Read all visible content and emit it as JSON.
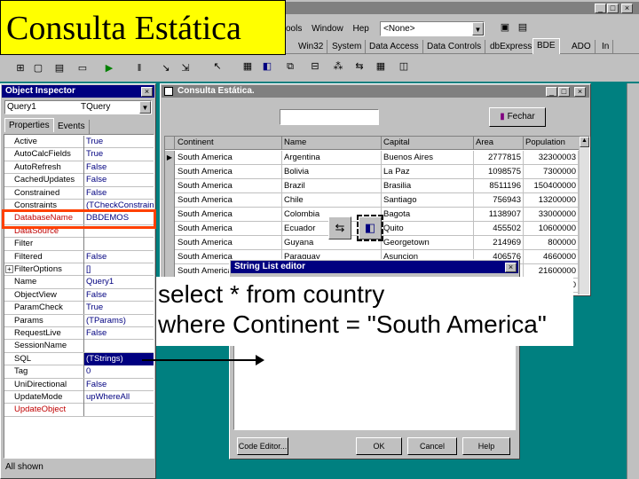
{
  "slide_title": "Consulta Estática",
  "ide": {
    "menu": [
      "ools",
      "Window",
      "Hep"
    ],
    "combo_value": "<None>",
    "palette_tabs": [
      "Win32",
      "System",
      "Data Access",
      "Data Controls",
      "dbExpress",
      "BDE",
      "ADO",
      "In"
    ]
  },
  "object_inspector": {
    "title": "Object Inspector",
    "component_name": "Query1",
    "component_type": "TQuery",
    "tabs": [
      "Properties",
      "Events"
    ],
    "properties": [
      {
        "name": "Active",
        "value": "True"
      },
      {
        "name": "AutoCalcFields",
        "value": "True"
      },
      {
        "name": "AutoRefresh",
        "value": "False"
      },
      {
        "name": "CachedUpdates",
        "value": "False"
      },
      {
        "name": "Constrained",
        "value": "False"
      },
      {
        "name": "Constraints",
        "value": "(TCheckConstraint"
      },
      {
        "name": "DatabaseName",
        "value": "DBDEMOS"
      },
      {
        "name": "DataSource",
        "value": ""
      },
      {
        "name": "Filter",
        "value": ""
      },
      {
        "name": "Filtered",
        "value": "False"
      },
      {
        "name": "FilterOptions",
        "value": "[]"
      },
      {
        "name": "Name",
        "value": "Query1"
      },
      {
        "name": "ObjectView",
        "value": "False"
      },
      {
        "name": "ParamCheck",
        "value": "True"
      },
      {
        "name": "Params",
        "value": "(TParams)"
      },
      {
        "name": "RequestLive",
        "value": "False"
      },
      {
        "name": "SessionName",
        "value": ""
      },
      {
        "name": "SQL",
        "value": "(TStrings)"
      },
      {
        "name": "Tag",
        "value": "0"
      },
      {
        "name": "UniDirectional",
        "value": "False"
      },
      {
        "name": "UpdateMode",
        "value": "upWhereAll"
      },
      {
        "name": "UpdateObject",
        "value": ""
      }
    ],
    "status": "All shown"
  },
  "form": {
    "title": "Consulta Estática.",
    "fechar_label": "Fechar",
    "grid": {
      "columns": [
        "Continent",
        "Name",
        "Capital",
        "Area",
        "Population"
      ],
      "rows": [
        [
          "South America",
          "Argentina",
          "Buenos Aires",
          "2777815",
          "32300003"
        ],
        [
          "South America",
          "Bolivia",
          "La Paz",
          "1098575",
          "7300000"
        ],
        [
          "South America",
          "Brazil",
          "Brasilia",
          "8511196",
          "150400000"
        ],
        [
          "South America",
          "Chile",
          "Santiago",
          "756943",
          "13200000"
        ],
        [
          "South America",
          "Colombia",
          "Bagota",
          "1138907",
          "33000000"
        ],
        [
          "South America",
          "Ecuador",
          "Quito",
          "455502",
          "10600000"
        ],
        [
          "South America",
          "Guyana",
          "Georgetown",
          "214969",
          "800000"
        ],
        [
          "South America",
          "Paraguay",
          "Asuncion",
          "406576",
          "4660000"
        ],
        [
          "South America",
          "",
          "",
          "",
          "21600000"
        ],
        [
          "",
          "",
          "",
          "",
          "0"
        ],
        [
          "",
          "",
          "",
          "",
          "0"
        ]
      ]
    }
  },
  "string_editor": {
    "title": "String List editor",
    "lines": [
      "select * from country",
      "where Continent = \"South America\""
    ],
    "buttons": {
      "code_editor": "Code Editor...",
      "ok": "OK",
      "cancel": "Cancel",
      "help": "Help"
    }
  },
  "colors": {
    "titlebar": "#000080",
    "face": "#c0c0c0",
    "desktop": "#008080",
    "highlight_box": "#ff4000",
    "slide_title_bg": "#ffff00"
  }
}
